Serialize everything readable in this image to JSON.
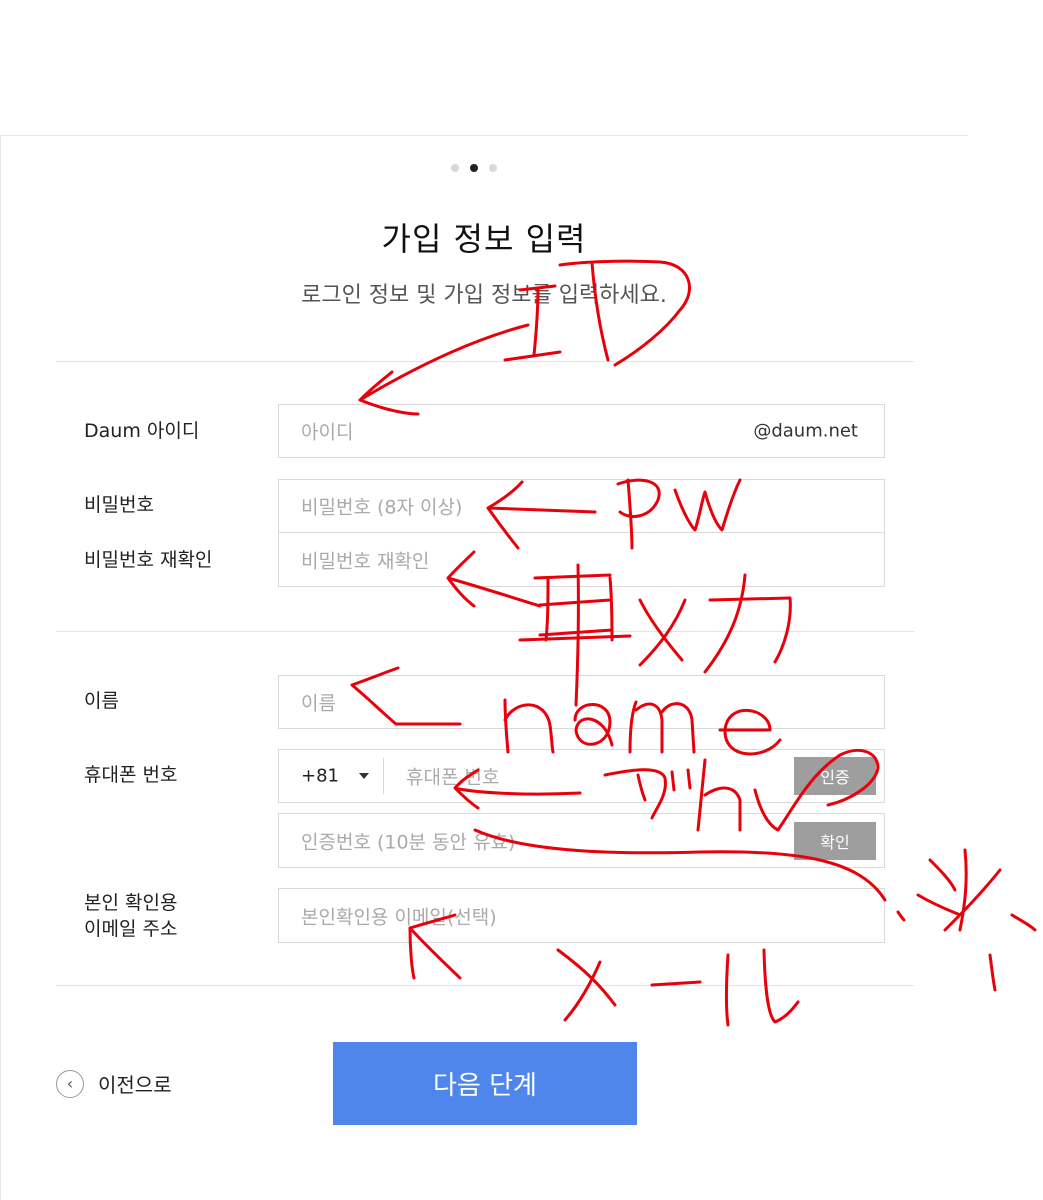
{
  "progress": {
    "total_steps": 3,
    "current_step": 2
  },
  "header": {
    "title": "가입 정보 입력",
    "subtitle": "로그인 정보 및 가입 정보를 입력하세요."
  },
  "account": {
    "id_label": "Daum 아이디",
    "id_placeholder": "아이디",
    "id_suffix": "@daum.net",
    "pw_label": "비밀번호",
    "pw_placeholder": "비밀번호 (8자 이상)",
    "pw_confirm_label": "비밀번호 재확인",
    "pw_confirm_placeholder": "비밀번호 재확인"
  },
  "profile": {
    "name_label": "이름",
    "name_placeholder": "이름",
    "phone_label": "휴대폰 번호",
    "country_code": "+81",
    "phone_placeholder": "휴대폰 번호",
    "verify_button": "인증",
    "code_placeholder": "인증번호 (10분 동안 유효)",
    "confirm_button": "확인",
    "email_label_line1": "본인 확인용",
    "email_label_line2": "이메일 주소",
    "email_placeholder": "본인확인용 이메일(선택)"
  },
  "footer": {
    "prev_label": "이전으로",
    "next_label": "다음 단계"
  },
  "annotation_color": "#e8000b"
}
